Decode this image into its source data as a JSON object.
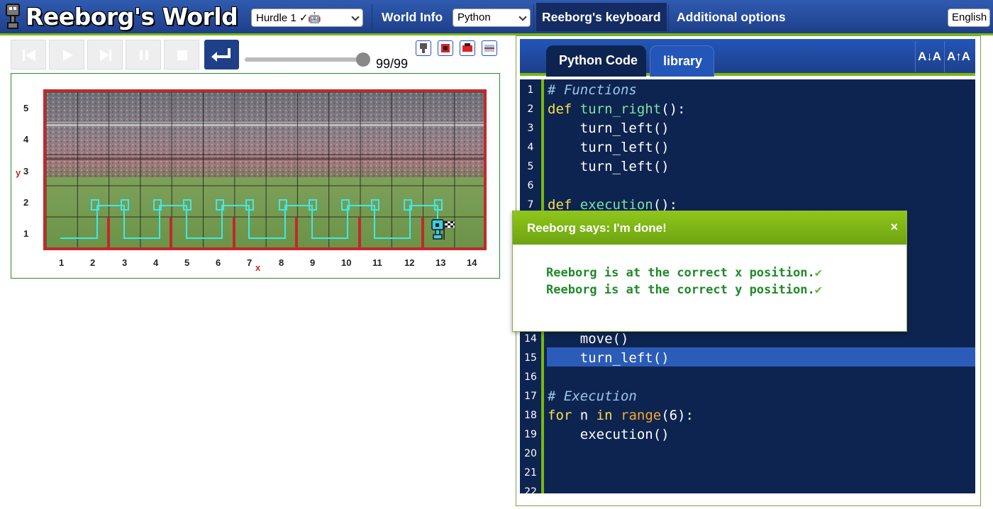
{
  "header": {
    "title": "Reeborg's World",
    "world_select": "Hurdle 1 ✓🤖",
    "world_info": "World Info",
    "language": "Python",
    "keyboard": "Reeborg's keyboard",
    "options": "Additional options",
    "ui_language": "English"
  },
  "controls": {
    "step_counter": "99/99",
    "speed_level": 1.0
  },
  "world": {
    "x_ticks": [
      "1",
      "2",
      "3",
      "4",
      "5",
      "6",
      "7",
      "8",
      "9",
      "10",
      "11",
      "12",
      "13",
      "14"
    ],
    "y_ticks": [
      "5",
      "4",
      "3",
      "2",
      "1"
    ],
    "x_label": "x",
    "y_label": "y",
    "robot_position": {
      "x": 13,
      "y": 1
    },
    "wall_color": "#c02a2a"
  },
  "editor": {
    "tabs": [
      "Python Code",
      "library"
    ],
    "font_decrease": "A↓A",
    "font_increase": "A↑A",
    "line_numbers": [
      "1",
      "2",
      "3",
      "4",
      "5",
      "6",
      "7",
      "",
      "",
      "",
      "",
      "",
      "",
      "14",
      "15",
      "16",
      "17",
      "18",
      "19",
      "20",
      "21",
      "22"
    ],
    "lines": {
      "l1": "# Functions",
      "l2_kw": "def",
      "l2_fn": "turn_right",
      "l2_rest": "():",
      "l3": "    turn_left()",
      "l4": "    turn_left()",
      "l5": "    turn_left()",
      "l7_kw": "def",
      "l7_fn": "execution",
      "l7_rest": "():",
      "l14": "    move()",
      "l15": "    turn_left()",
      "l17": "# Execution",
      "l18_for": "for",
      "l18_n": " n ",
      "l18_in": "in",
      "l18_range": "range",
      "l18_rest": "(6):",
      "l19": "    execution()"
    },
    "colors": {
      "keyword": "#f6e24a",
      "comment": "#9ac8e8",
      "function": "#7fe3a3",
      "builtin": "#f7a72e"
    }
  },
  "dialog": {
    "title": "Reeborg says: I'm done!",
    "close": "×",
    "messages": [
      "Reeborg is at the correct x position.",
      "Reeborg is at the correct y position."
    ],
    "check": "✔"
  }
}
